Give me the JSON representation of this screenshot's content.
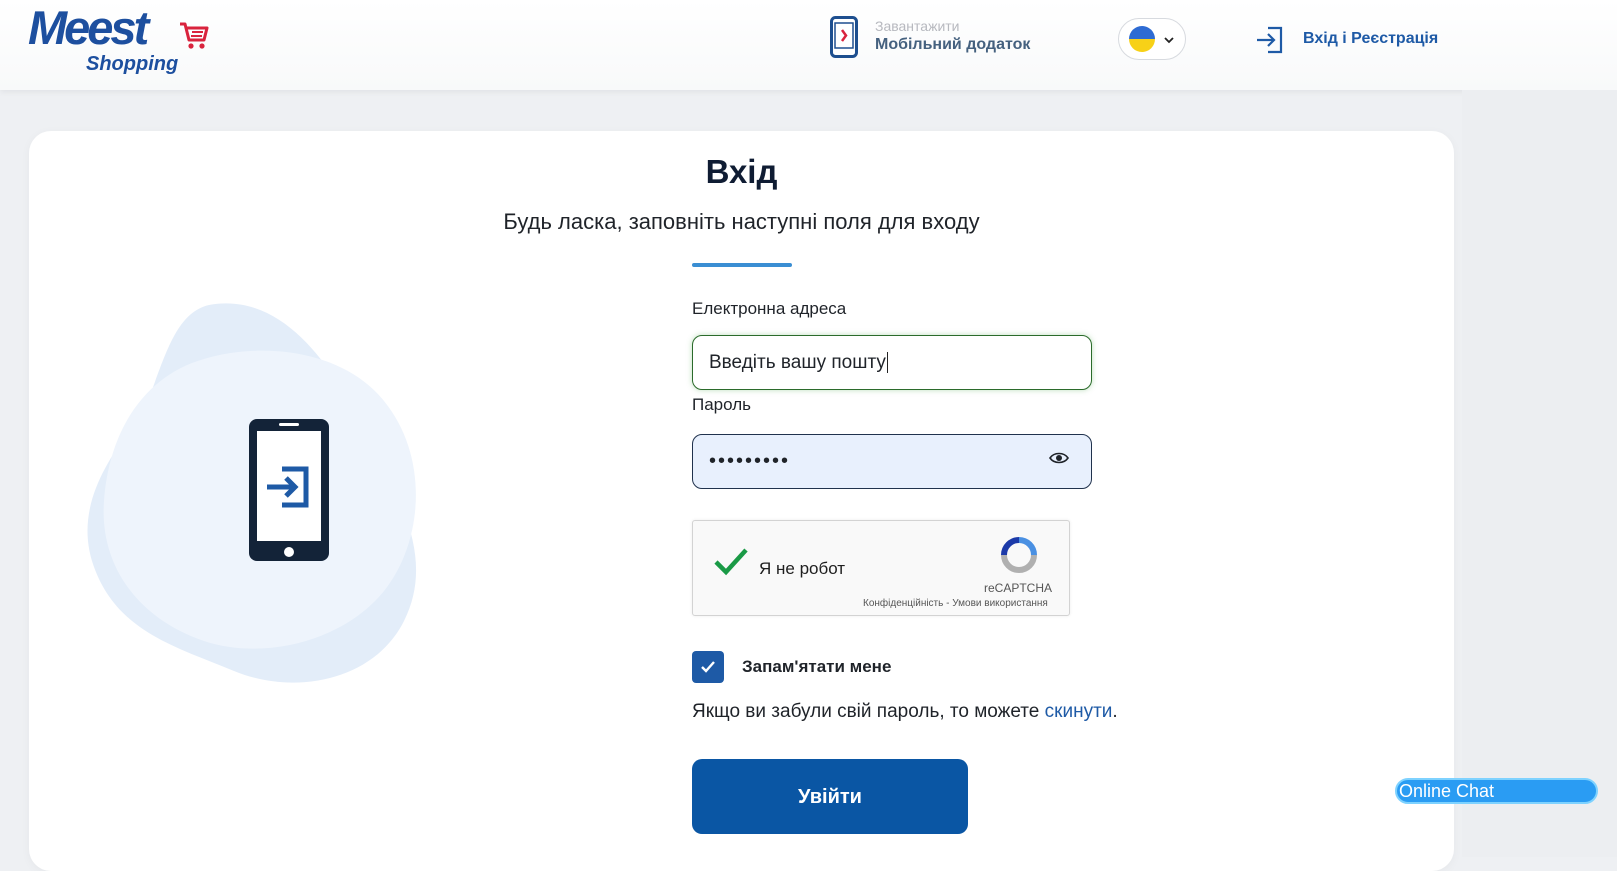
{
  "header": {
    "logo_main": "Meest",
    "logo_sub": "Shopping",
    "app_small": "Завантажити",
    "app_big": "Мобільний додаток",
    "login_label": "Вхід і Реєстрація"
  },
  "login": {
    "title": "Вхід",
    "subtitle": "Будь ласка, заповніть наступні поля для входу",
    "email_label": "Електронна адреса",
    "email_value": "Введіть вашу пошту",
    "password_label": "Пароль",
    "password_value": "•••••••••",
    "captcha_label": "Я не робот",
    "captcha_brand": "reCAPTCHA",
    "captcha_terms": "Конфіденційність - Умови використання",
    "remember_label": "Запам'ятати мене",
    "forgot_prefix": "Якщо ви забули свій пароль, то можете ",
    "forgot_link": "скинути",
    "forgot_suffix": ".",
    "submit_label": "Увійти"
  },
  "chat": {
    "label": "Online Chat"
  },
  "colors": {
    "brand_blue": "#1d4f9f",
    "button_blue": "#0a56a4",
    "accent_blue": "#3a8ed3",
    "chat_blue": "#2a9cf3",
    "cart_red": "#d9233d"
  },
  "icons": {
    "app": "phone-icon",
    "login": "sign-in-icon",
    "language": "ukraine-flag-icon",
    "password_toggle": "eye-icon"
  }
}
